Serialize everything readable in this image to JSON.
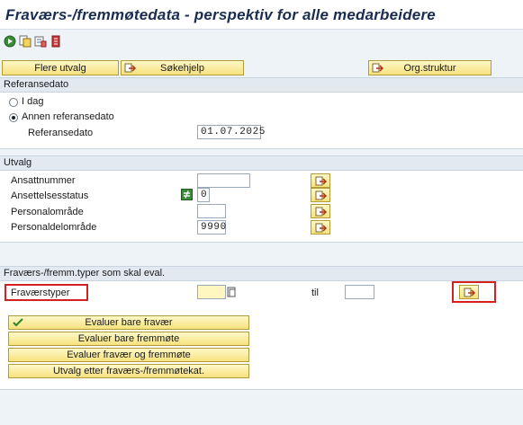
{
  "window": {
    "title": "Fraværs-/fremmøtedata - perspektiv for alle medarbeidere"
  },
  "toolbar": {
    "icons": [
      "execute-icon",
      "variant-icon",
      "save-variant-icon",
      "info-icon"
    ],
    "buttons": {
      "flere_utvalg": "Flere utvalg",
      "sokehjelp": "Søkehjelp",
      "org_struktur": "Org.struktur"
    }
  },
  "referansedato": {
    "header": "Referansedato",
    "option_today": "I dag",
    "option_other": "Annen referansedato",
    "selected": "Annen referansedato",
    "field_label": "Referansedato",
    "field_value": "01.07.2025"
  },
  "utvalg": {
    "header": "Utvalg",
    "rows": [
      {
        "label": "Ansattnummer",
        "value": ""
      },
      {
        "label": "Ansettelsesstatus",
        "value": "0",
        "has_not_equal_icon": true
      },
      {
        "label": "Personalområde",
        "value": ""
      },
      {
        "label": "Personaldelområde",
        "value": "9990"
      }
    ]
  },
  "fravaer": {
    "header": "Fraværs-/fremm.typer som skal eval.",
    "field_label": "Fraværstyper",
    "from_value": "",
    "to_label": "til",
    "to_value": ""
  },
  "eval_buttons": {
    "evaluer_fravaer": "Evaluer bare fravær",
    "evaluer_fremmote": "Evaluer bare fremmøte",
    "evaluer_begge": "Evaluer fravær og fremmøte",
    "utvalg_kat": "Utvalg etter fraværs-/fremmøtekat."
  },
  "colors": {
    "highlight": "#d52020",
    "button_yellow": "#f6e27d",
    "section_header": "#e2e9f1",
    "title": "#1b2c52"
  }
}
